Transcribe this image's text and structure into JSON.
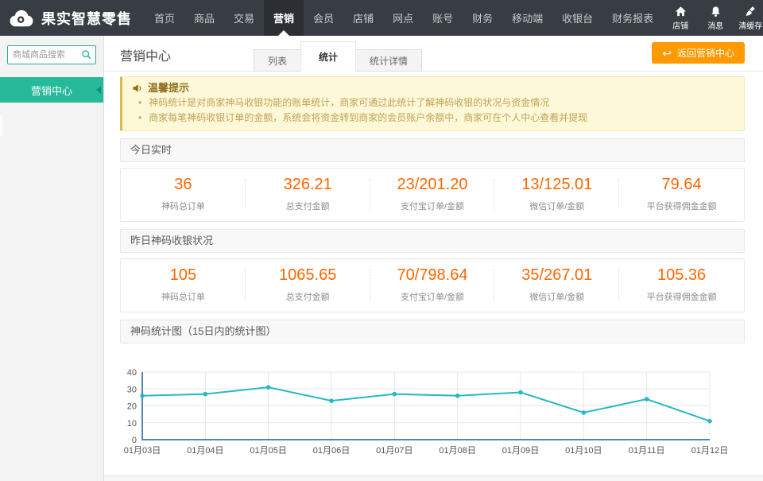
{
  "topbar": {
    "brand": "果实智慧零售",
    "nav": [
      "首页",
      "商品",
      "交易",
      "营销",
      "会员",
      "店铺",
      "网点",
      "账号",
      "财务",
      "移动端",
      "收银台",
      "财务报表"
    ],
    "active_nav": "营销",
    "quick": [
      {
        "icon": "home-icon",
        "label": "店铺"
      },
      {
        "icon": "bell-icon",
        "label": "消息"
      },
      {
        "icon": "broom-icon",
        "label": "清缓存"
      }
    ]
  },
  "sidebar": {
    "search_placeholder": "商城商品搜索",
    "items": [
      {
        "label": "营销中心",
        "active": true
      }
    ]
  },
  "header": {
    "title": "营销中心",
    "tabs": [
      {
        "label": "列表"
      },
      {
        "label": "统计",
        "active": true
      },
      {
        "label": "统计详情"
      }
    ],
    "back_label": "返回营销中心",
    "back_icon": "↩"
  },
  "tips": {
    "title": "温馨提示",
    "lines": [
      "神码统计是对商家神马收银功能的账单统计，商家可通过此统计了解神码收银的状况与资金情况",
      "商家每笔神码收银订单的金额，系统会将资金转到商家的会员账户余额中，商家可在个人中心查看并提现"
    ]
  },
  "sections": [
    {
      "title": "今日实时",
      "stats": [
        {
          "value": "36",
          "label": "神码总订单"
        },
        {
          "value": "326.21",
          "label": "总支付金额"
        },
        {
          "value": "23/201.20",
          "label": "支付宝订单/金额"
        },
        {
          "value": "13/125.01",
          "label": "微信订单/金额"
        },
        {
          "value": "79.64",
          "label": "平台获得佣金金额"
        }
      ]
    },
    {
      "title": "昨日神码收银状况",
      "stats": [
        {
          "value": "105",
          "label": "神码总订单"
        },
        {
          "value": "1065.65",
          "label": "总支付金额"
        },
        {
          "value": "70/798.64",
          "label": "支付宝订单/金额"
        },
        {
          "value": "35/267.01",
          "label": "微信订单/金额"
        },
        {
          "value": "105.36",
          "label": "平台获得佣金金额"
        }
      ]
    }
  ],
  "chart_data": {
    "type": "line",
    "title": "神码统计图（15日内的统计图）",
    "x": [
      "01月03日",
      "01月04日",
      "01月05日",
      "01月06日",
      "01月07日",
      "01月08日",
      "01月09日",
      "01月10日",
      "01月11日",
      "01月12日"
    ],
    "values": [
      26,
      27,
      31,
      23,
      27,
      26,
      28,
      16,
      24,
      11
    ],
    "ylim": [
      0,
      40
    ],
    "yticks": [
      0,
      10,
      20,
      30,
      40
    ],
    "grid": true,
    "legend": false,
    "line_color": "#26b9c3",
    "axis_color": "#5585b5"
  },
  "colors": {
    "accent_teal": "#26b99a",
    "topbar_bg": "#383d43",
    "topbar_active_bg": "#2b2f34",
    "button_orange": "#ff9900",
    "stat_number": "#ff6600",
    "tips_bg": "#fdf8d7",
    "chart_line": "#26b9c3",
    "chart_axis": "#5585b5"
  }
}
